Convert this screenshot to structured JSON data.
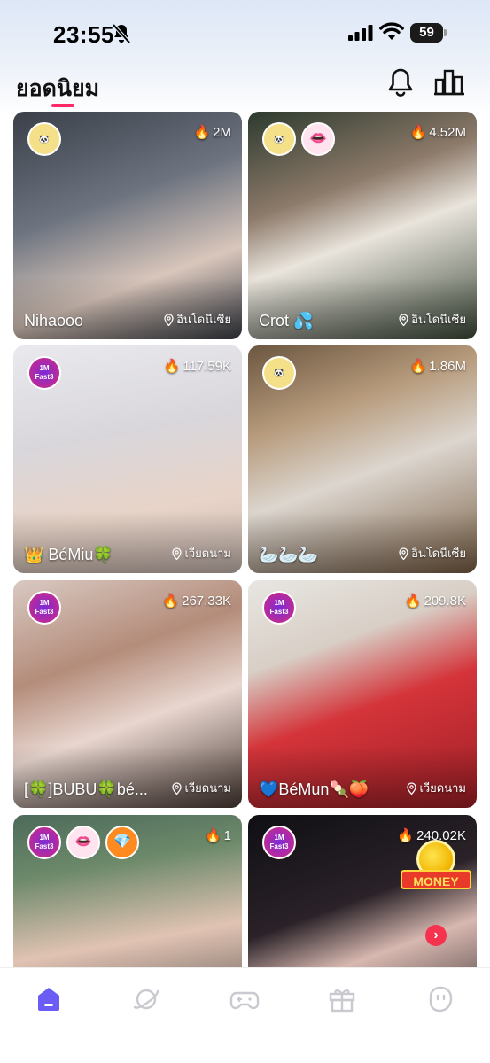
{
  "status_bar": {
    "time": "23:55",
    "battery": "59"
  },
  "header": {
    "title": "ยอดนิยม"
  },
  "streams": [
    {
      "name": "Nihaooo",
      "viewers": "2M",
      "location": "อินโดนีเซีย",
      "badges": [
        "panda-badge"
      ],
      "bg": "linear-gradient(160deg,#3a3f48 0%,#6d7480 40%,#d9c6bb 70%,#3b3f47 100%)"
    },
    {
      "name": "Crot 💦",
      "viewers": "4.52M",
      "location": "อินโดนีเซีย",
      "badges": [
        "panda-badge",
        "lips-badge"
      ],
      "bg": "linear-gradient(160deg,#2c3a2e 0%,#8d7a6a 35%,#e9e4dc 55%,#3d4a3a 100%)"
    },
    {
      "name": "👑 BéMiu🍀",
      "viewers": "117.59K",
      "location": "เวียดนาม",
      "badges": [
        "fast3-badge"
      ],
      "bg": "linear-gradient(170deg,#e9e9ee 0%,#d9d6db 40%,#e8d4c8 70%,#c9b8b0 100%)"
    },
    {
      "name": "🦢🦢🦢",
      "viewers": "1.86M",
      "location": "อินโดนีเซีย",
      "badges": [
        "panda-badge"
      ],
      "bg": "linear-gradient(160deg,#6b5640 0%,#b79b7c 30%,#dcd6cf 55%,#7a5f45 100%)"
    },
    {
      "name": "[🍀]BUBU🍀bé...",
      "viewers": "267.33K",
      "location": "เวียดนาม",
      "badges": [
        "fast3-badge"
      ],
      "bg": "linear-gradient(160deg,#d9c9c2 0%,#b48c7a 35%,#e8d6cf 60%,#4a3a34 100%)"
    },
    {
      "name": "💙BéMun🍡🍑",
      "viewers": "209.8K",
      "location": "เวียดนาม",
      "badges": [
        "fast3-badge"
      ],
      "bg": "linear-gradient(160deg,#e8e6e2 0%,#d8cfc6 30%,#d4343a 55%,#9e1f26 100%)"
    },
    {
      "name": "",
      "viewers": "1",
      "location": "",
      "badges": [
        "fast3-badge",
        "lips-badge",
        "gem-badge"
      ],
      "bg": "linear-gradient(170deg,#4c6a5a 0%,#6e8a6b 25%,#e1c3b3 55%,#3a3a3a 100%)"
    },
    {
      "name": "",
      "viewers": "240.02K",
      "location": "",
      "badges": [
        "fast3-badge"
      ],
      "bg": "linear-gradient(160deg,#0f0f14 0%,#2a2228 40%,#d8b8b0 60%,#1a1418 100%)"
    }
  ],
  "badge_text": {
    "panda": "🐼",
    "fast3": "1M\nFast3",
    "lips": "👄",
    "gem": "💎"
  },
  "promo": {
    "money_label": "MONEY"
  },
  "nav": {
    "items": [
      "home-icon",
      "explore-icon",
      "games-icon",
      "gift-icon",
      "profile-icon"
    ],
    "active_color": "#6a5cf5",
    "inactive_color": "#c9c9cf"
  }
}
